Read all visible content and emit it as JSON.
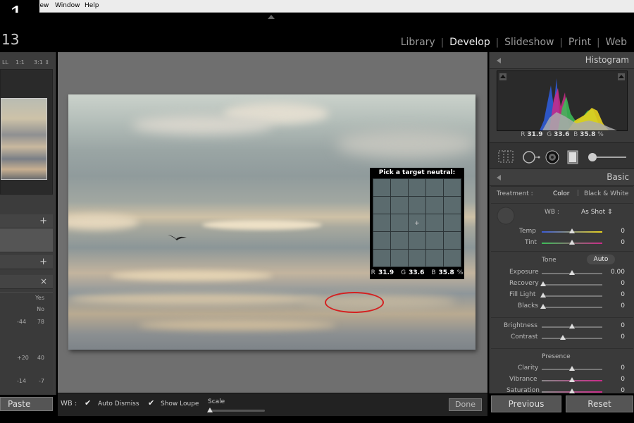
{
  "step_badge": "1",
  "menubar": {
    "items": [
      "View",
      "Window",
      "Help"
    ]
  },
  "catalog_num": "13",
  "modules": [
    "Library",
    "Develop",
    "Slideshow",
    "Print",
    "Web"
  ],
  "active_module": "Develop",
  "left_panel": {
    "zoom_options": [
      "LL",
      "1:1",
      "3:1 ⇕"
    ],
    "plus_icon": "+",
    "close_icon": "×",
    "history_values": [
      {
        "left": "",
        "right": "Yes"
      },
      {
        "left": "",
        "right": "No"
      },
      {
        "left": "-44",
        "right": "78"
      },
      {
        "left": "+20",
        "right": "40"
      },
      {
        "left": "-14",
        "right": "-7"
      }
    ],
    "paste_label": "Paste"
  },
  "loupe": {
    "title": "Pick a target neutral:",
    "r_label": "R",
    "r_value": "31.9",
    "g_label": "G",
    "g_value": "33.6",
    "b_label": "B",
    "b_value": "35.8",
    "unit": "%"
  },
  "toolbar": {
    "wb_label": "WB :",
    "auto_dismiss_label": "Auto Dismiss",
    "auto_dismiss_checked": true,
    "show_loupe_label": "Show Loupe",
    "show_loupe_checked": true,
    "scale_label": "Scale",
    "done_label": "Done"
  },
  "right_panel": {
    "histogram_title": "Histogram",
    "readout": {
      "r": "31.9",
      "g": "33.6",
      "b": "35.8",
      "unit": "%"
    },
    "basic_title": "Basic",
    "treatment_label": "Treatment :",
    "treatment_color": "Color",
    "treatment_bw": "Black & White",
    "wb_label": "WB :",
    "wb_value": "As Shot ⇕",
    "temp": {
      "label": "Temp",
      "value": "0"
    },
    "tint": {
      "label": "Tint",
      "value": "0"
    },
    "tone_label": "Tone",
    "auto_label": "Auto",
    "exposure": {
      "label": "Exposure",
      "value": "0.00"
    },
    "recovery": {
      "label": "Recovery",
      "value": "0"
    },
    "fill_light": {
      "label": "Fill Light",
      "value": "0"
    },
    "blacks": {
      "label": "Blacks",
      "value": "0"
    },
    "brightness": {
      "label": "Brightness",
      "value": "0"
    },
    "contrast": {
      "label": "Contrast",
      "value": "0"
    },
    "presence_label": "Presence",
    "clarity": {
      "label": "Clarity",
      "value": "0"
    },
    "vibrance": {
      "label": "Vibrance",
      "value": "0"
    },
    "saturation": {
      "label": "Saturation",
      "value": "0"
    },
    "previous_label": "Previous",
    "reset_label": "Reset"
  },
  "colors": {
    "selection_oval": "#d42020",
    "panel_bg": "#3a3a3a",
    "canvas_bg": "#6f6f6f"
  }
}
